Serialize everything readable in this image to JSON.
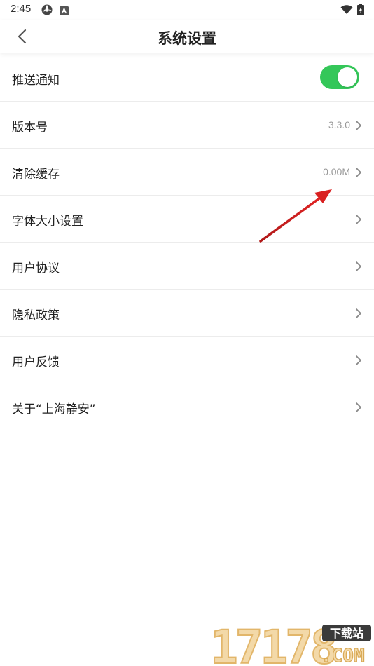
{
  "status_bar": {
    "time": "2:45"
  },
  "header": {
    "title": "系统设置"
  },
  "settings": {
    "items": [
      {
        "label": "推送通知",
        "value": "",
        "toggle_on": true
      },
      {
        "label": "版本号",
        "value": "3.3.0"
      },
      {
        "label": "清除缓存",
        "value": "0.00M"
      },
      {
        "label": "字体大小设置",
        "value": ""
      },
      {
        "label": "用户协议",
        "value": ""
      },
      {
        "label": "隐私政策",
        "value": ""
      },
      {
        "label": "用户反馈",
        "value": ""
      },
      {
        "label": "关于“上海静安”",
        "value": ""
      }
    ]
  },
  "watermark": {
    "number": "17178",
    "site": "下载站",
    "com": ".COM"
  },
  "colors": {
    "toggle_on": "#34c759",
    "arrow": "#d92020",
    "watermark_gold": "#e7b96a"
  },
  "icons": {
    "back": "chevron-left-icon",
    "row_arrow": "chevron-right-icon",
    "wifi": "wifi-icon",
    "battery": "battery-icon"
  }
}
